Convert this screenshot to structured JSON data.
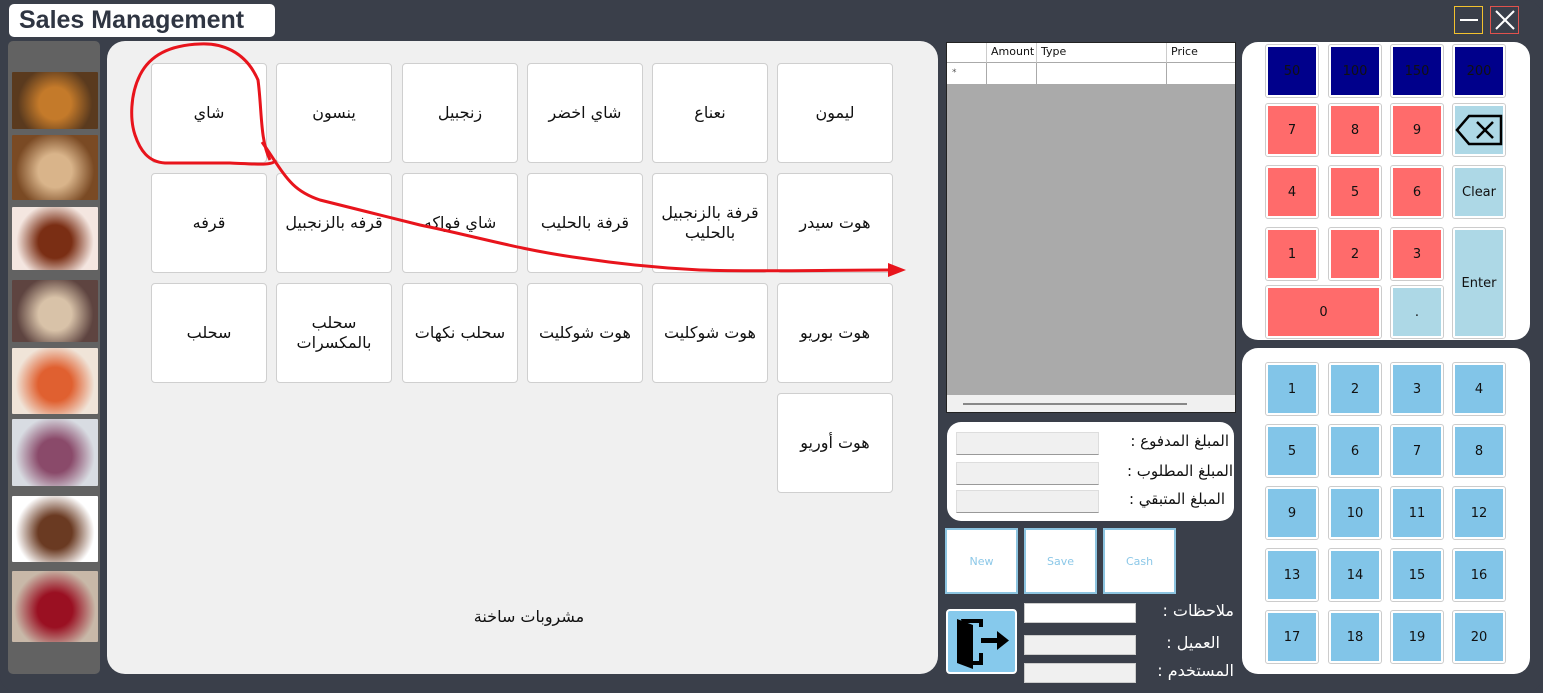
{
  "window": {
    "title": "Sales Management",
    "minimize_icon": "minimize-icon",
    "close_icon": "close-icon"
  },
  "sidebar": {
    "categories": [
      {
        "name": "hot-drinks-image",
        "colors": [
          "#5a3a1e",
          "#c47a2a"
        ]
      },
      {
        "name": "coffee-image",
        "colors": [
          "#7a4a24",
          "#d9b48a"
        ]
      },
      {
        "name": "cold-drinks-image",
        "colors": [
          "#f4e6e0",
          "#7a2e14"
        ]
      },
      {
        "name": "milkshakes-image",
        "colors": [
          "#5e4440",
          "#d8c2a8"
        ]
      },
      {
        "name": "juices-image",
        "colors": [
          "#f0e4d8",
          "#e06030"
        ]
      },
      {
        "name": "smoothies-image",
        "colors": [
          "#d8dce2",
          "#8a4a6a"
        ]
      },
      {
        "name": "ice-cream-image",
        "colors": [
          "#ffffff",
          "#6a3a22"
        ]
      },
      {
        "name": "cakes-image",
        "colors": [
          "#c8b8a8",
          "#9a1022"
        ]
      }
    ]
  },
  "menu": {
    "items": [
      "ليمون",
      "نعناع",
      "شاي اخضر",
      "زنجبيل",
      "ينسون",
      "شاي",
      "هوت سيدر",
      "قرفة بالزنجبيل بالحليب",
      "قرفة بالحليب",
      "شاي فواكه",
      "قرفه بالزنجبيل",
      "قرفه",
      "هوت بوريو",
      "هوت شوكليت",
      "هوت شوكليت",
      "سحلب نكهات",
      "سحلب بالمكسرات",
      "سحلب",
      "هوت أوريو"
    ],
    "category_label": "مشروبات ساخنة"
  },
  "order_grid": {
    "columns": [
      "",
      "Amount",
      "Type",
      "Price"
    ],
    "new_row_marker": "*",
    "rows": []
  },
  "totals": {
    "paid_label": "المبلغ المدفوع :",
    "paid_value": "",
    "required_label": "المبلغ  المطلوب :",
    "required_value": "",
    "remaining_label": "المبلغ المتبقي :",
    "remaining_value": ""
  },
  "actions": {
    "new_label": "New",
    "save_label": "Save",
    "cash_label": "Cash",
    "exit_icon": "exit-door-icon"
  },
  "footer_fields": {
    "notes_label": "ملاحظات :",
    "notes_value": "",
    "customer_label": "العميل :",
    "customer_value": "",
    "user_label": "المستخدم :",
    "user_value": ""
  },
  "keypad": {
    "quick_amounts": [
      "50",
      "100",
      "150",
      "200"
    ],
    "digits": [
      "7",
      "8",
      "9",
      "4",
      "5",
      "6",
      "1",
      "2",
      "3",
      "0",
      "."
    ],
    "backspace_icon": "backspace-icon",
    "clear_label": "Clear",
    "enter_label": "Enter"
  },
  "tables": {
    "numbers": [
      "1",
      "2",
      "3",
      "4",
      "5",
      "6",
      "7",
      "8",
      "9",
      "10",
      "11",
      "12",
      "13",
      "14",
      "15",
      "16",
      "17",
      "18",
      "19",
      "20"
    ]
  },
  "colors": {
    "window_bg": "#3a3f4a",
    "quick_amount": "#00008b",
    "digit": "#ff6b6b",
    "function_key": "#add8e6",
    "table_key": "#82c5e8",
    "annotation": "#e8141c"
  }
}
